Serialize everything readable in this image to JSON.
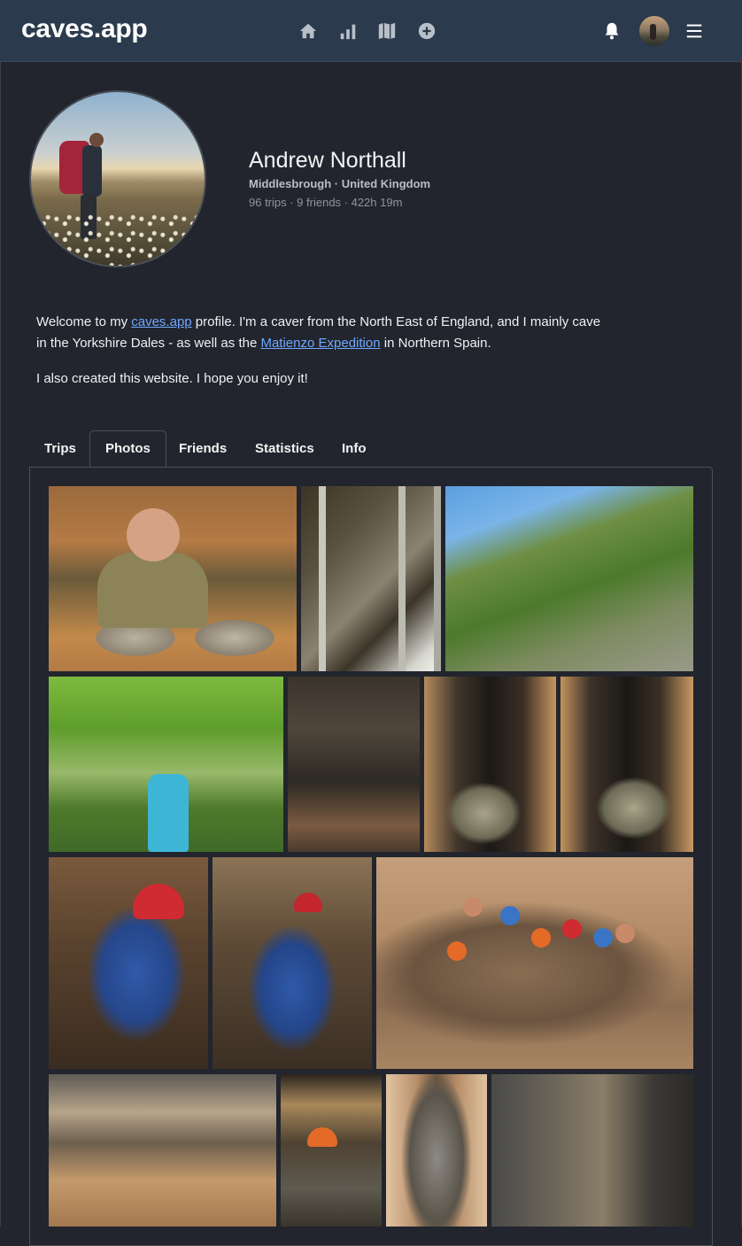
{
  "nav": {
    "brand": "caves.app",
    "icons": [
      "home-icon",
      "stats-icon",
      "map-icon",
      "add-icon",
      "bell-icon",
      "menu-icon"
    ]
  },
  "profile": {
    "name": "Andrew Northall",
    "location": "Middlesbrough · United Kingdom",
    "stats": "96 trips · 9 friends · 422h 19m"
  },
  "bio": {
    "p1_a": "Welcome to my ",
    "p1_link1": "caves.app",
    "p1_b": " profile. I'm a caver from the North East of England, and I mainly cave in the Yorkshire Dales - as well as the ",
    "p1_link2": "Matienzo Expedition",
    "p1_c": " in Northern Spain.",
    "p2": "I also created this website. I hope you enjoy it!"
  },
  "tabs": [
    {
      "label": "Trips",
      "active": false
    },
    {
      "label": "Photos",
      "active": true
    },
    {
      "label": "Friends",
      "active": false
    },
    {
      "label": "Statistics",
      "active": false
    },
    {
      "label": "Info",
      "active": false
    }
  ],
  "colors": {
    "navbar": "#2b3a4c",
    "background": "#22252d",
    "link": "#6fa8ff"
  }
}
